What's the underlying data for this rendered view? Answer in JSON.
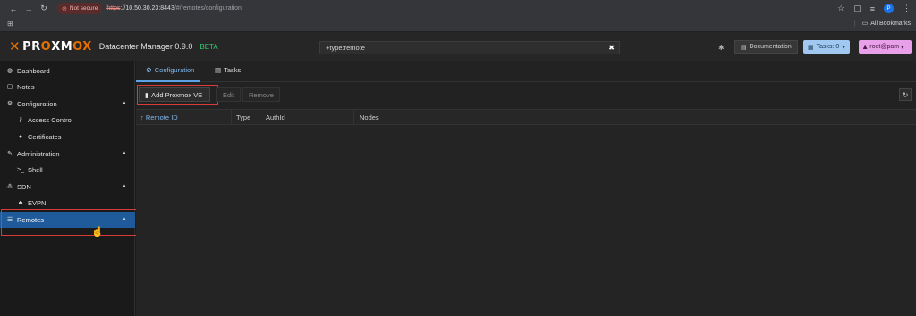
{
  "browser": {
    "security_label": "Not secure",
    "url_protocol": "https",
    "url_host": "://10.50.30.23:8443",
    "url_path": "/#/remotes/configuration",
    "all_bookmarks": "All Bookmarks",
    "profile_initial": "P"
  },
  "header": {
    "logo_pr": "PR",
    "logo_o": "O",
    "logo_xm": "XM",
    "logo_ox": "OX",
    "product": "Datacenter Manager 0.9.0",
    "beta": "BETA",
    "search_value": "+type:remote",
    "documentation_label": "Documentation",
    "tasks_label": "Tasks: 0",
    "user_label": "root@pam"
  },
  "sidebar": {
    "items": [
      {
        "label": "Dashboard",
        "icon": "dashboard-icon"
      },
      {
        "label": "Notes",
        "icon": "notes-icon"
      },
      {
        "label": "Configuration",
        "icon": "gears-icon"
      },
      {
        "label": "Access Control",
        "icon": "key-icon"
      },
      {
        "label": "Certificates",
        "icon": "certificate-icon"
      },
      {
        "label": "Administration",
        "icon": "wrench-icon"
      },
      {
        "label": "Shell",
        "icon": "terminal-icon"
      },
      {
        "label": "SDN",
        "icon": "sdn-icon"
      },
      {
        "label": "EVPN",
        "icon": "sitemap-icon"
      },
      {
        "label": "Remotes",
        "icon": "server-list-icon"
      }
    ]
  },
  "main": {
    "tabs": [
      {
        "label": "Configuration"
      },
      {
        "label": "Tasks"
      }
    ],
    "toolbar": {
      "add_label": "Add Proxmox VE",
      "edit_label": "Edit",
      "remove_label": "Remove"
    },
    "columns": [
      "Remote ID",
      "Type",
      "AuthId",
      "Nodes"
    ]
  },
  "colors": {
    "accent": "#5ba3e6",
    "active_sidebar": "#1f5a9a",
    "logo_orange": "#e57000",
    "beta_green": "#2ecc71",
    "highlight_red": "#d93a3a"
  }
}
